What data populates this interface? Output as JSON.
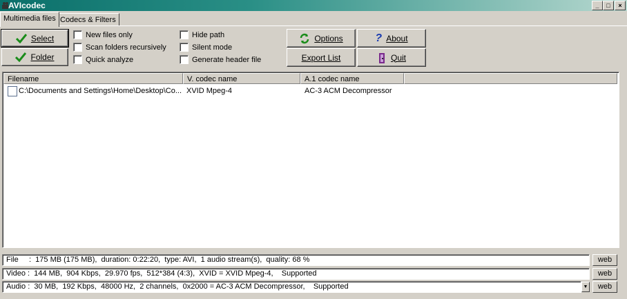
{
  "window": {
    "title": "AVIcodec"
  },
  "tabs": [
    {
      "label": "Multimedia files"
    },
    {
      "label": "Codecs & Filters"
    }
  ],
  "buttons": {
    "select": "Select",
    "folder": "Folder",
    "options": "Options",
    "about": "About",
    "export": "Export List",
    "quit": "Quit"
  },
  "checkboxes": {
    "new_files_only": "New files only",
    "scan_folders": "Scan folders recursively",
    "quick_analyze": "Quick analyze",
    "hide_path": "Hide path",
    "silent_mode": "Silent mode",
    "generate_header": "Generate header file"
  },
  "list": {
    "columns": [
      "Filename",
      "V. codec name",
      "A.1 codec name"
    ],
    "rows": [
      {
        "filename": "C:\\Documents and Settings\\Home\\Desktop\\Co...",
        "vcodec": "XVID Mpeg-4",
        "acodec": "AC-3 ACM Decompressor"
      }
    ]
  },
  "info": {
    "file": "File     :  175 MB (175 MB),  duration: 0:22:20,  type: AVI,  1 audio stream(s),  quality: 68 %",
    "video": "Video :  144 MB,  904 Kbps,  29.970 fps,  512*384 (4:3),  XVID = XVID Mpeg-4,    Supported",
    "audio": "Audio :  30 MB,  192 Kbps,  48000 Hz,  2 channels,  0x2000 = AC-3 ACM Decompressor,    Supported",
    "web_label": "web"
  }
}
